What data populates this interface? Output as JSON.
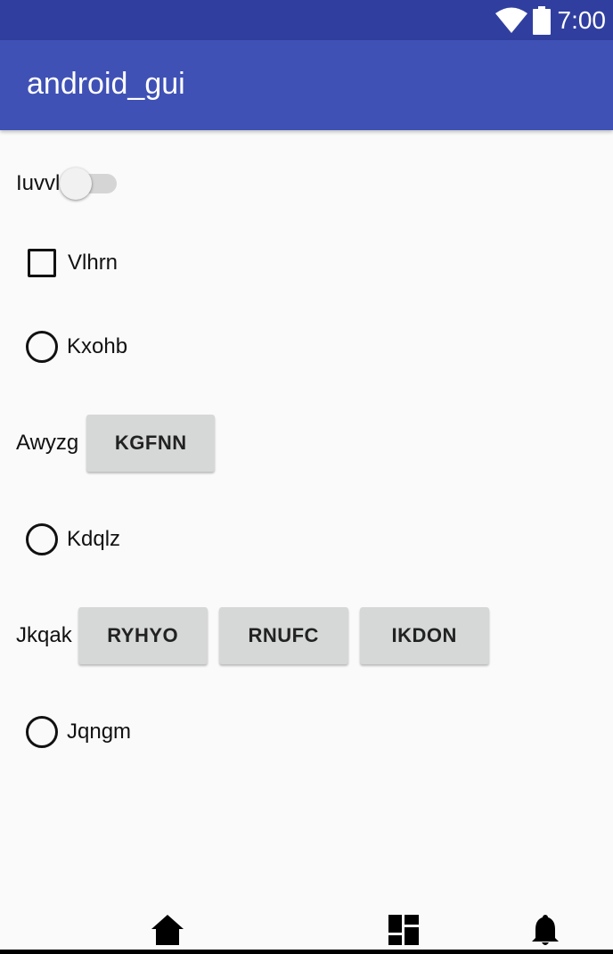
{
  "status_bar": {
    "time": "7:00",
    "icons": [
      "wifi-icon",
      "battery-icon"
    ]
  },
  "app_bar": {
    "title": "android_gui"
  },
  "switch_row": {
    "label": "Iuvvl",
    "checked": false
  },
  "checkbox_row": {
    "label": "Vlhrn",
    "checked": false
  },
  "radio_1": {
    "label": "Kxohb",
    "checked": false
  },
  "button_row_1": {
    "label": "Awyzg",
    "buttons": [
      "KGFNN"
    ]
  },
  "radio_2": {
    "label": "Kdqlz",
    "checked": false
  },
  "button_row_2": {
    "label": "Jkqak",
    "buttons": [
      "RYHYO",
      "RNUFC",
      "IKDON"
    ]
  },
  "radio_3": {
    "label": "Jqngm",
    "checked": false
  },
  "bottom_nav": {
    "icons": [
      "home-icon",
      "dashboard-icon",
      "notifications-icon"
    ]
  },
  "colors": {
    "status_bar": "#303f9f",
    "app_bar": "#3f51b5",
    "background": "#fafafa",
    "button": "#d6d7d7"
  }
}
